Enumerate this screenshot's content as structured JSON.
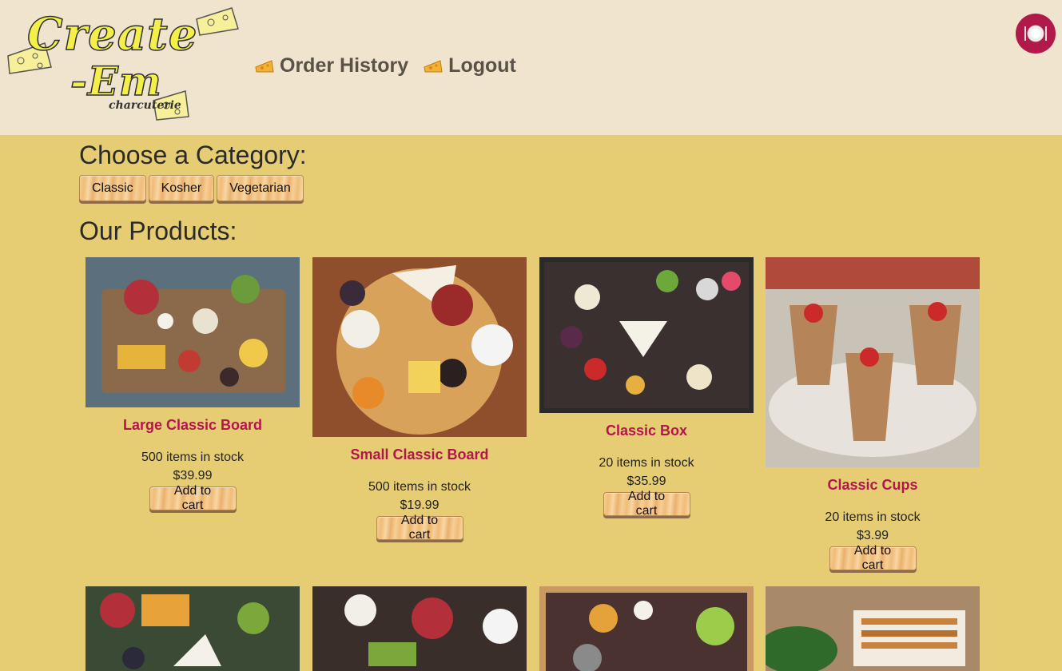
{
  "brand": {
    "line1": "Create",
    "line2": "-Em",
    "tagline": "charcuterie"
  },
  "nav": [
    {
      "label": "Order History",
      "icon": "cheese-icon"
    },
    {
      "label": "Logout",
      "icon": "cheese-icon"
    }
  ],
  "avatar": {
    "icon": "plate-icon",
    "color": "#b0194a"
  },
  "categories": {
    "heading": "Choose a Category:",
    "items": [
      "Classic",
      "Kosher",
      "Vegetarian"
    ]
  },
  "products": {
    "heading": "Our Products:",
    "add_label": "Add to cart",
    "items": [
      {
        "name": "Large Classic Board",
        "stock": "500 items in stock",
        "price": "$39.99"
      },
      {
        "name": "Small Classic Board",
        "stock": "500 items in stock",
        "price": "$19.99"
      },
      {
        "name": "Classic Box",
        "stock": "20 items in stock",
        "price": "$35.99"
      },
      {
        "name": "Classic Cups",
        "stock": "20 items in stock",
        "price": "$3.99"
      }
    ]
  },
  "colors": {
    "page_bg": "#e6cd74",
    "header_bg": "#f0e4cf",
    "accent": "#b3154d"
  }
}
